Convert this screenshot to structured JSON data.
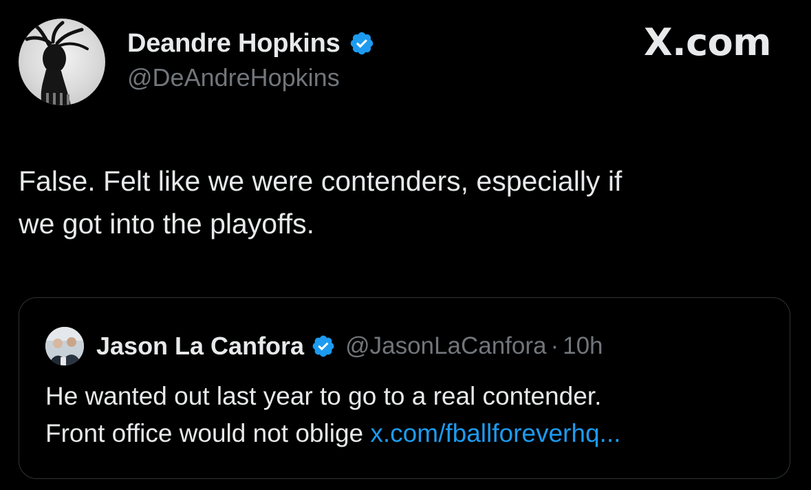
{
  "author": {
    "name": "Deandre Hopkins",
    "handle": "@DeAndreHopkins",
    "verified_icon": "verified-badge-icon"
  },
  "brand": {
    "label": "X.com"
  },
  "tweet": {
    "line1": "False. Felt like we were contenders, especially if",
    "line2": "we got into the playoffs."
  },
  "quoted": {
    "name": "Jason La Canfora",
    "handle": "@JasonLaCanfora",
    "separator": "·",
    "time": "10h",
    "line1": "He wanted out last year to go to a real contender.",
    "line2_text": "Front office would not oblige ",
    "link": "x.com/fballforeverhq..."
  },
  "colors": {
    "background": "#000000",
    "text_primary": "#e7e9ea",
    "text_secondary": "#71767b",
    "verified_blue": "#1d9bf0",
    "link": "#1d9bf0",
    "border": "#2f3336"
  }
}
